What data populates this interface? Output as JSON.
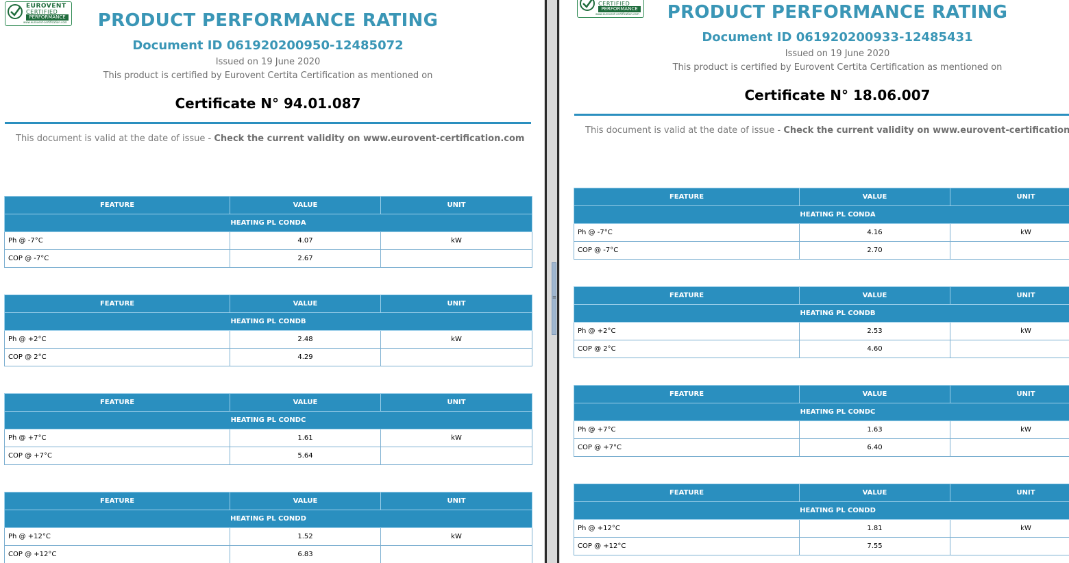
{
  "logo": {
    "line1": "EUROVENT",
    "line2": "CERTIFIED",
    "line3": "PERFORMANCE",
    "url": "www.eurovent-certification.com"
  },
  "columns": {
    "feature": "FEATURE",
    "value": "VALUE",
    "unit": "UNIT"
  },
  "left": {
    "title": "PRODUCT PERFORMANCE RATING",
    "document_id": "Document ID 061920200950-12485072",
    "issued": "Issued on  19 June 2020",
    "certified_text": "This product is certified by Eurovent Certita Certification as mentioned on",
    "certificate": "Certificate N° 94.01.087",
    "validity_prefix": "This document is valid at the date of issue - ",
    "validity_bold": "Check the current validity on www.eurovent-certification.com",
    "tables": [
      {
        "group": "HEATING PL CONDA",
        "rows": [
          {
            "feature": "Ph @ -7°C",
            "value": "4.07",
            "unit": "kW"
          },
          {
            "feature": "COP @ -7°C",
            "value": "2.67",
            "unit": ""
          }
        ]
      },
      {
        "group": "HEATING PL CONDB",
        "rows": [
          {
            "feature": "Ph @ +2°C",
            "value": "2.48",
            "unit": "kW"
          },
          {
            "feature": "COP @ 2°C",
            "value": "4.29",
            "unit": ""
          }
        ]
      },
      {
        "group": "HEATING PL CONDC",
        "rows": [
          {
            "feature": "Ph @ +7°C",
            "value": "1.61",
            "unit": "kW"
          },
          {
            "feature": "COP @ +7°C",
            "value": "5.64",
            "unit": ""
          }
        ]
      },
      {
        "group": "HEATING PL CONDD",
        "rows": [
          {
            "feature": "Ph @ +12°C",
            "value": "1.52",
            "unit": "kW"
          },
          {
            "feature": "COP @ +12°C",
            "value": "6.83",
            "unit": ""
          }
        ]
      }
    ]
  },
  "right": {
    "title": "PRODUCT PERFORMANCE RATING",
    "document_id": "Document ID 061920200933-12485431",
    "issued": "Issued on  19 June 2020",
    "certified_text": "This product is certified by Eurovent Certita Certification as mentioned on",
    "certificate": "Certificate N° 18.06.007",
    "validity_prefix": "This document is valid at the date of issue - ",
    "validity_bold": "Check the current validity on www.eurovent-certification.",
    "tables": [
      {
        "group": "HEATING PL CONDA",
        "rows": [
          {
            "feature": "Ph @ -7°C",
            "value": "4.16",
            "unit": "kW"
          },
          {
            "feature": "COP @ -7°C",
            "value": "2.70",
            "unit": ""
          }
        ]
      },
      {
        "group": "HEATING PL CONDB",
        "rows": [
          {
            "feature": "Ph @ +2°C",
            "value": "2.53",
            "unit": "kW"
          },
          {
            "feature": "COP @ 2°C",
            "value": "4.60",
            "unit": ""
          }
        ]
      },
      {
        "group": "HEATING PL CONDC",
        "rows": [
          {
            "feature": "Ph @ +7°C",
            "value": "1.63",
            "unit": "kW"
          },
          {
            "feature": "COP @ +7°C",
            "value": "6.40",
            "unit": ""
          }
        ]
      },
      {
        "group": "HEATING PL CONDD",
        "rows": [
          {
            "feature": "Ph @ +12°C",
            "value": "1.81",
            "unit": "kW"
          },
          {
            "feature": "COP @ +12°C",
            "value": "7.55",
            "unit": ""
          }
        ]
      }
    ]
  },
  "colors": {
    "accent": "#3a96b6",
    "table_header": "#2a8fbf",
    "logo_green": "#1e6b3b"
  }
}
